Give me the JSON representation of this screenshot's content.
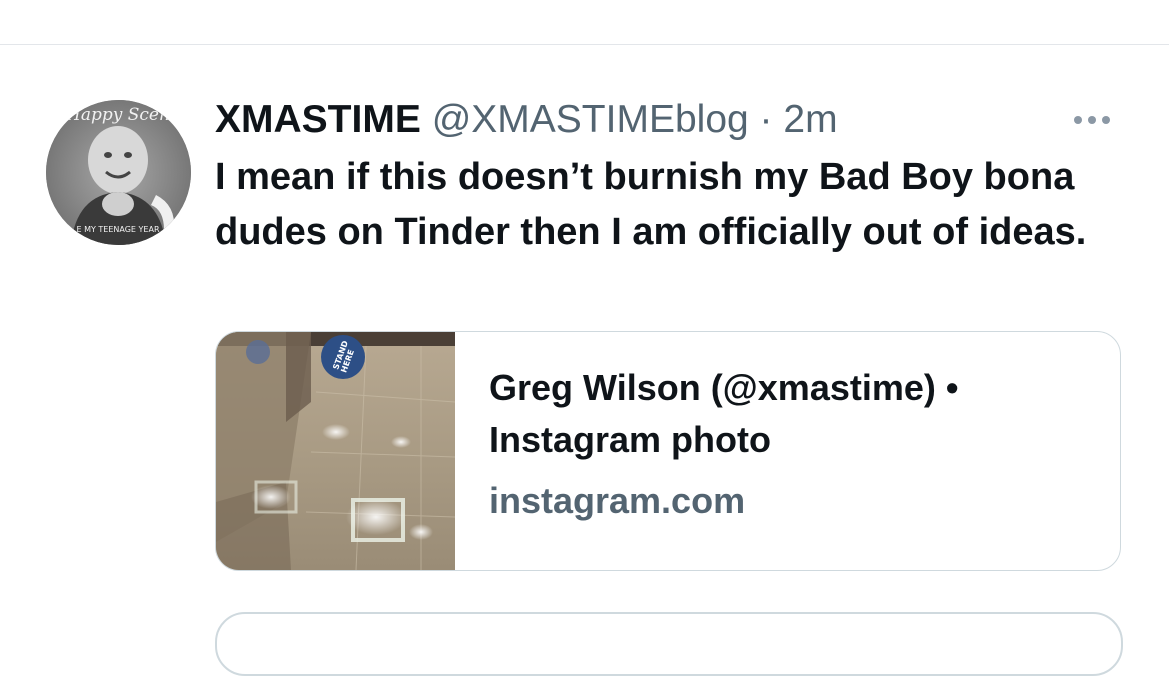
{
  "tweet": {
    "author": {
      "display_name": "XMASTIME",
      "handle": "@XMASTIMEblog",
      "avatar_top_text": "Happy Scen",
      "avatar_bottom_text": "E MY TEENAGE YEAR"
    },
    "separator": "·",
    "timestamp": "2m",
    "more_icon": "more-horizontal-icon",
    "text": "I mean if this doesn’t burnish my Bad Boy bona dudes on Tinder then I am officially out of ideas.",
    "link_card": {
      "title": "Greg Wilson (@xmastime) • Instagram photo",
      "domain": "instagram.com",
      "sticker_text": [
        "STAND",
        "HERE"
      ]
    }
  },
  "colors": {
    "text_primary": "#0f1419",
    "text_secondary": "#536471",
    "border": "#cfd9de"
  }
}
